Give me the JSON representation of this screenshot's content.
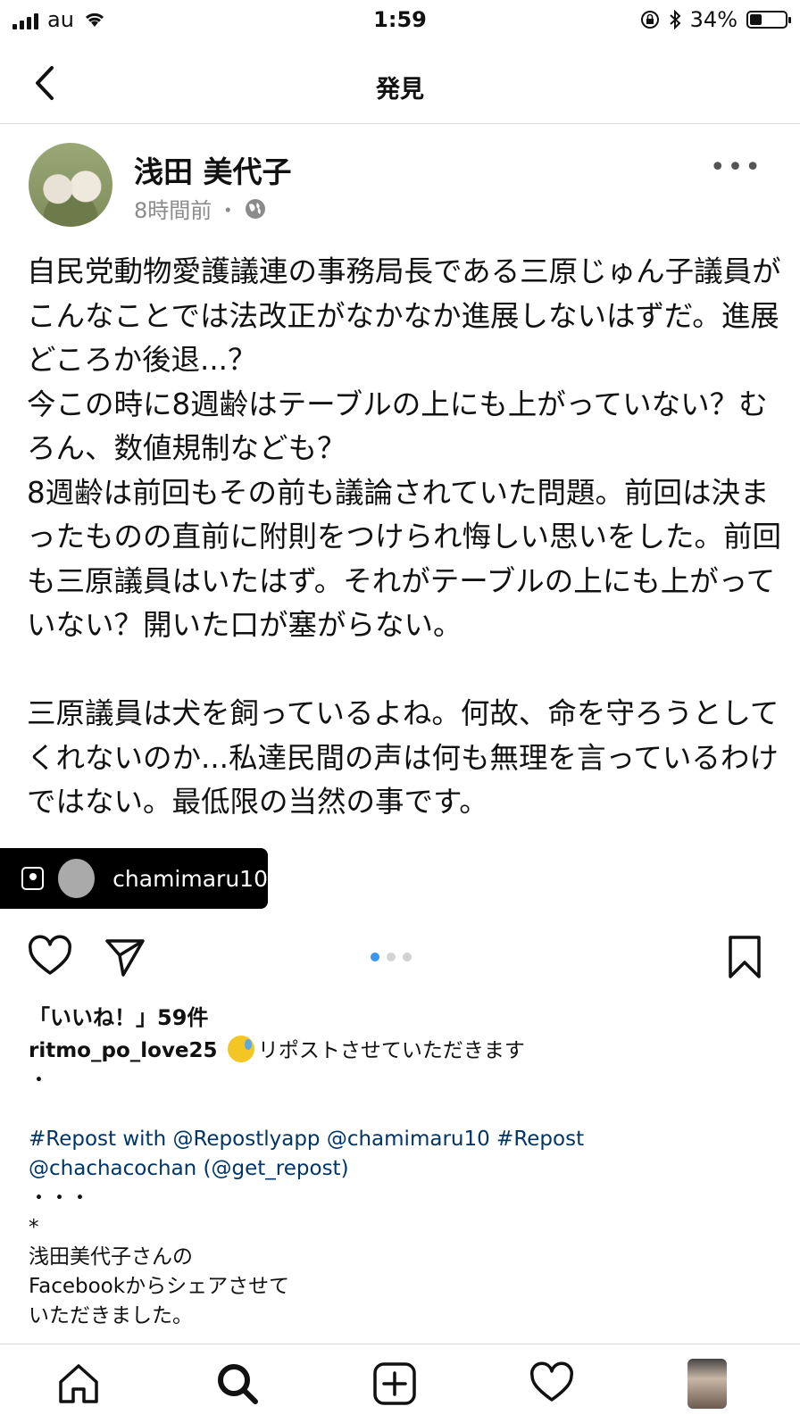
{
  "status_bar": {
    "carrier": "au",
    "time": "1:59",
    "battery_percent": "34%",
    "battery_level": 0.34
  },
  "nav": {
    "title": "発見"
  },
  "post": {
    "author": "浅田 美代子",
    "time_ago": "8時間前",
    "meta_separator": "・",
    "more_label": "•••",
    "text": "自民党動物愛護議連の事務局長である三原じゅん子議員がこんなことでは法改正がなかなか進展しないはずだ。進展どころか後退...？\n今この時に8週齢はテーブルの上にも上がっていない？むろん、数値規制なども？\n8週齢は前回もその前も議論されていた問題。前回は決まったものの直前に附則をつけられ悔しい思いをした。前回も三原議員はいたはず。それがテーブルの上にも上がっていない？開いた口が塞がらない。\n\n三原議員は犬を飼っているよね。何故、命を守ろうとしてくれないのか...私達民間の声は何も無理を言っているわけではない。最低限の当然の事です。",
    "tagged_user": "chamimaru10",
    "carousel": {
      "count": 3,
      "active_index": 0
    }
  },
  "likes": "「いいね！」59件",
  "caption": {
    "username": "ritmo_po_love25",
    "text": "リポストさせていただきます",
    "dot_line": "・",
    "hashtags": "#Repost with @Repostlyapp @chamimaru10 #Repost\n@chachacochan (@get_repost)",
    "dots_line": "・・・",
    "asterisk": "*",
    "body": "浅田美代子さんの\nFacebookからシェアさせて\nいただきました。"
  },
  "tabbar": {
    "items": [
      "home-icon",
      "search-icon",
      "add-icon",
      "heart-icon",
      "profile-avatar"
    ]
  }
}
